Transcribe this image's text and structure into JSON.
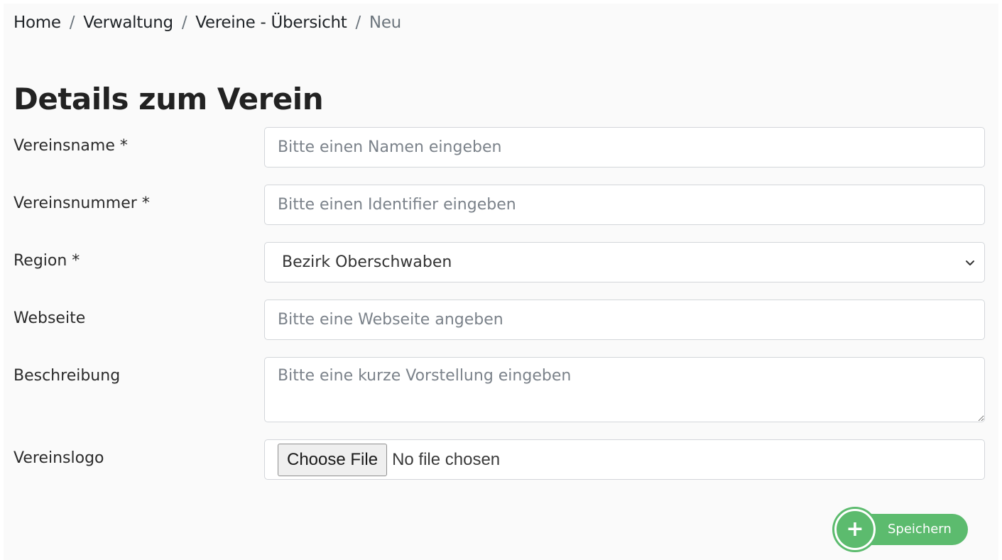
{
  "breadcrumb": {
    "items": [
      "Home",
      "Verwaltung",
      "Vereine - Übersicht"
    ],
    "separator": "/",
    "active": "Neu"
  },
  "page": {
    "title": "Details zum Verein"
  },
  "form": {
    "name": {
      "label": "Vereinsname *",
      "placeholder": "Bitte einen Namen eingeben",
      "value": ""
    },
    "number": {
      "label": "Vereinsnummer *",
      "placeholder": "Bitte einen Identifier eingeben",
      "value": ""
    },
    "region": {
      "label": "Region *",
      "selected": "Bezirk Oberschwaben"
    },
    "website": {
      "label": "Webseite",
      "placeholder": "Bitte eine Webseite angeben",
      "value": ""
    },
    "description": {
      "label": "Beschreibung",
      "placeholder": "Bitte eine kurze Vorstellung eingeben",
      "value": ""
    },
    "logo": {
      "label": "Vereinslogo",
      "button_label": "Choose File",
      "status": "No file chosen"
    }
  },
  "actions": {
    "save_label": "Speichern",
    "save_icon": "plus-icon",
    "accent_color": "#5cbb6e"
  }
}
